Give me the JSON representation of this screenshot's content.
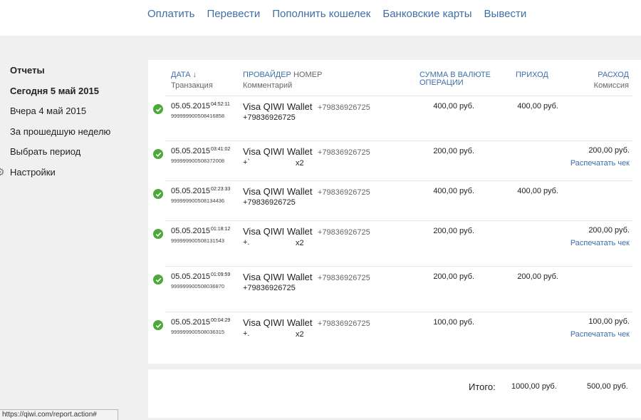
{
  "topnav": [
    "Оплатить",
    "Перевести",
    "Пополнить кошелек",
    "Банковские карты",
    "Вывести"
  ],
  "sidebar": {
    "items": [
      "Отчеты",
      "Сегодня 5 май 2015",
      "Вчера 4 май 2015",
      "За прошедшую неделю",
      "Выбрать период"
    ],
    "settings": "Настройки"
  },
  "headers": {
    "date": "ДАТА ↓",
    "transaction": "Транзакция",
    "provider": "ПРОВАЙДЕР",
    "number": "НОМЕР",
    "comment": "Комментарий",
    "amount_line1": "СУММА В ВАЛЮТЕ",
    "amount_line2": "ОПЕРАЦИИ",
    "income": "ПРИХОД",
    "expense": "РАСХОД",
    "commission": "Комиссия"
  },
  "rows": [
    {
      "date": "05.05.2015",
      "time": "04:52:11",
      "txn": "999999900508416858",
      "provider": "Visa QIWI Wallet",
      "number": "+79836926725",
      "comment": "+79836926725",
      "x2": "",
      "amount": "400,00 руб.",
      "income": "400,00 руб.",
      "expense": "",
      "receipt": ""
    },
    {
      "date": "05.05.2015",
      "time": "03:41:02",
      "txn": "999999900508372008",
      "provider": "Visa QIWI Wallet",
      "number": "+79836926725",
      "comment": "+`",
      "x2": "x2",
      "amount": "200,00 руб.",
      "income": "",
      "expense": "200,00 руб.",
      "receipt": "Распечатать чек"
    },
    {
      "date": "05.05.2015",
      "time": "02:23:33",
      "txn": "999999900508134436",
      "provider": "Visa QIWI Wallet",
      "number": "+79836926725",
      "comment": "+79836926725",
      "x2": "",
      "amount": "400,00 руб.",
      "income": "400,00 руб.",
      "expense": "",
      "receipt": ""
    },
    {
      "date": "05.05.2015",
      "time": "01:18:12",
      "txn": "999999900508131543",
      "provider": "Visa QIWI Wallet",
      "number": "+79836926725",
      "comment": "+.",
      "x2": "x2",
      "amount": "200,00 руб.",
      "income": "",
      "expense": "200,00 руб.",
      "receipt": "Распечатать чек"
    },
    {
      "date": "05.05.2015",
      "time": "01:09:59",
      "txn": "999999900508036870",
      "provider": "Visa QIWI Wallet",
      "number": "+79836926725",
      "comment": "+79836926725",
      "x2": "",
      "amount": "200,00 руб.",
      "income": "200,00 руб.",
      "expense": "",
      "receipt": ""
    },
    {
      "date": "05.05.2015",
      "time": "00:04:29",
      "txn": "999999900508036315",
      "provider": "Visa QIWI Wallet",
      "number": "+79836926725",
      "comment": "+.",
      "x2": "x2",
      "amount": "100,00 руб.",
      "income": "",
      "expense": "100,00 руб.",
      "receipt": "Распечатать чек"
    }
  ],
  "totals": {
    "label": "Итого:",
    "income": "1000,00 руб.",
    "expense": "500,00 руб."
  },
  "status_url": "https://qiwi.com/report.action#",
  "colors": {
    "link": "#3f6ea8",
    "check": "#4caa3c",
    "background": "#f0f0f0",
    "panel": "#ffffff"
  },
  "icons": {
    "check": "check-circle-icon",
    "settings": "gear-icon"
  }
}
